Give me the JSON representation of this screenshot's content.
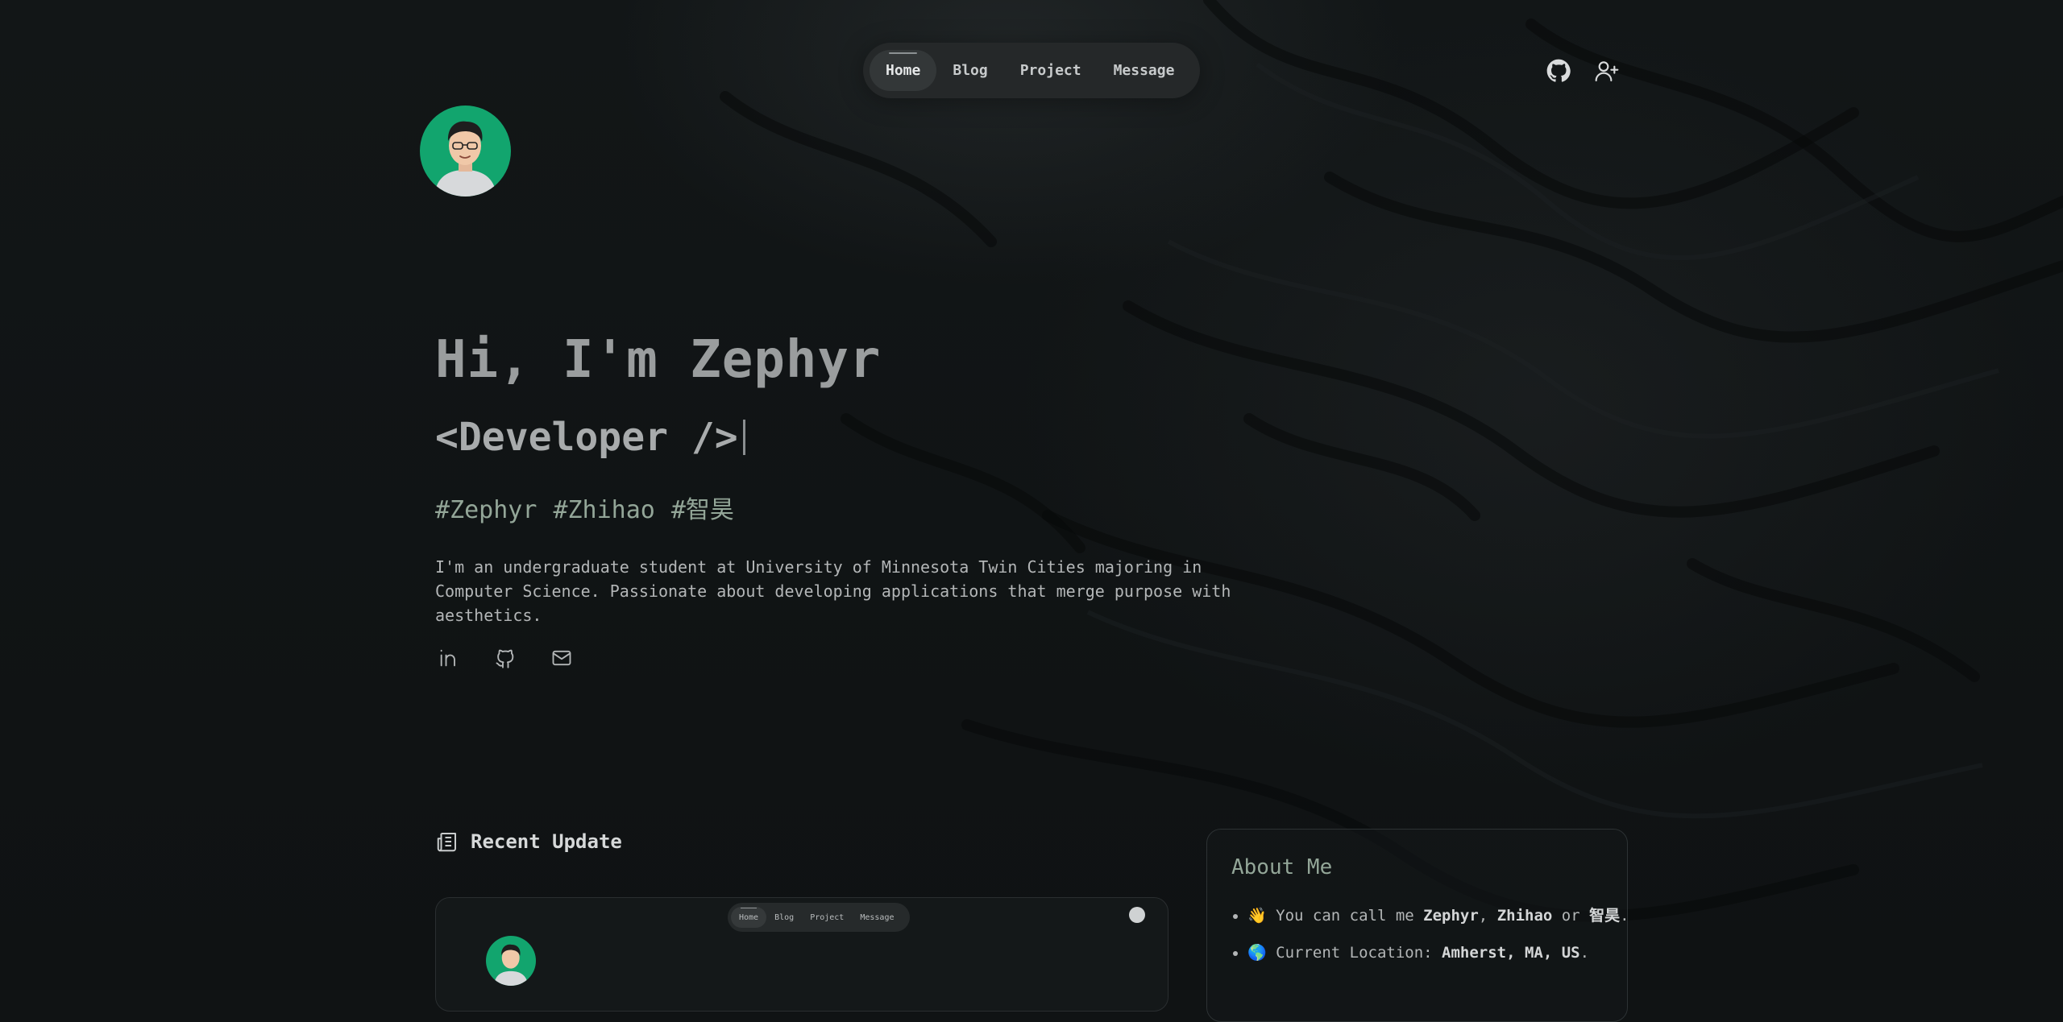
{
  "nav": {
    "items": [
      {
        "label": "Home",
        "active": true
      },
      {
        "label": "Blog",
        "active": false
      },
      {
        "label": "Project",
        "active": false
      },
      {
        "label": "Message",
        "active": false
      }
    ],
    "icons": [
      "github-icon",
      "user-plus-icon"
    ]
  },
  "hero": {
    "title": "Hi, I'm Zephyr",
    "role": "<Developer />",
    "tags": [
      "#Zephyr",
      "#Zhihao",
      "#智昊"
    ],
    "bio": "I'm an undergraduate student at University of Minnesota Twin Cities majoring in Computer Science. Passionate about developing applications that merge purpose with aesthetics.",
    "socials": [
      "linkedin-icon",
      "github-icon",
      "mail-icon"
    ]
  },
  "recent_update": {
    "title": "Recent Update",
    "icon": "newspaper-icon",
    "preview_nav": [
      "Home",
      "Blog",
      "Project",
      "Message"
    ]
  },
  "about": {
    "title": "About Me",
    "line1": {
      "emoji": "👋",
      "prefix": "You can call me ",
      "name1": "Zephyr",
      "sep1": ", ",
      "name2": "Zhihao",
      "sep2": " or ",
      "name3": "智昊",
      "end": "."
    },
    "line2": {
      "emoji": "🌎",
      "prefix": "Current Location: ",
      "value": "Amherst, MA, US",
      "end": "."
    }
  },
  "colors": {
    "background": "#101314",
    "accent_green": "#93a698",
    "avatar_green": "#12a56e"
  }
}
